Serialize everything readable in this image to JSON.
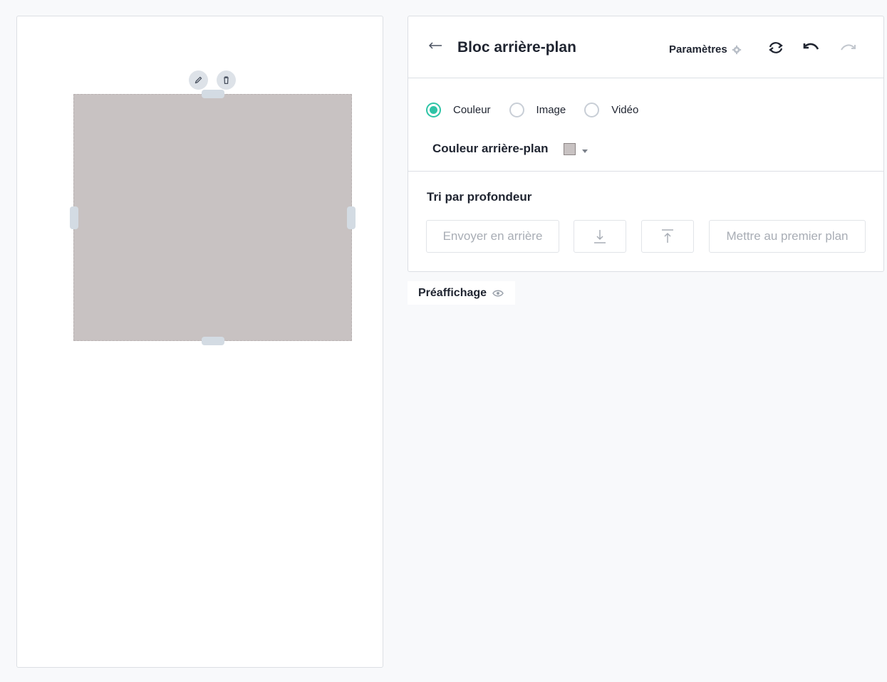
{
  "panel": {
    "title": "Bloc arrière-plan",
    "settings_label": "Paramètres",
    "icons": {
      "back": "arrow-left-icon",
      "settings": "gear-icon",
      "refresh": "sync-icon",
      "undo": "undo-icon",
      "redo": "redo-icon"
    }
  },
  "background_type": {
    "options": [
      {
        "label": "Couleur",
        "checked": true
      },
      {
        "label": "Image",
        "checked": false
      },
      {
        "label": "Vidéo",
        "checked": false
      }
    ],
    "color_label": "Couleur arrière-plan",
    "color_value": "#c8c2c2"
  },
  "depth_sort": {
    "title": "Tri par profondeur",
    "send_back_label": "Envoyer en arrière",
    "bring_front_label": "Mettre au premier plan"
  },
  "preview": {
    "label": "Préaffichage"
  },
  "canvas": {
    "block_color": "#c8c2c2",
    "accent_color": "#2ec4a6"
  }
}
